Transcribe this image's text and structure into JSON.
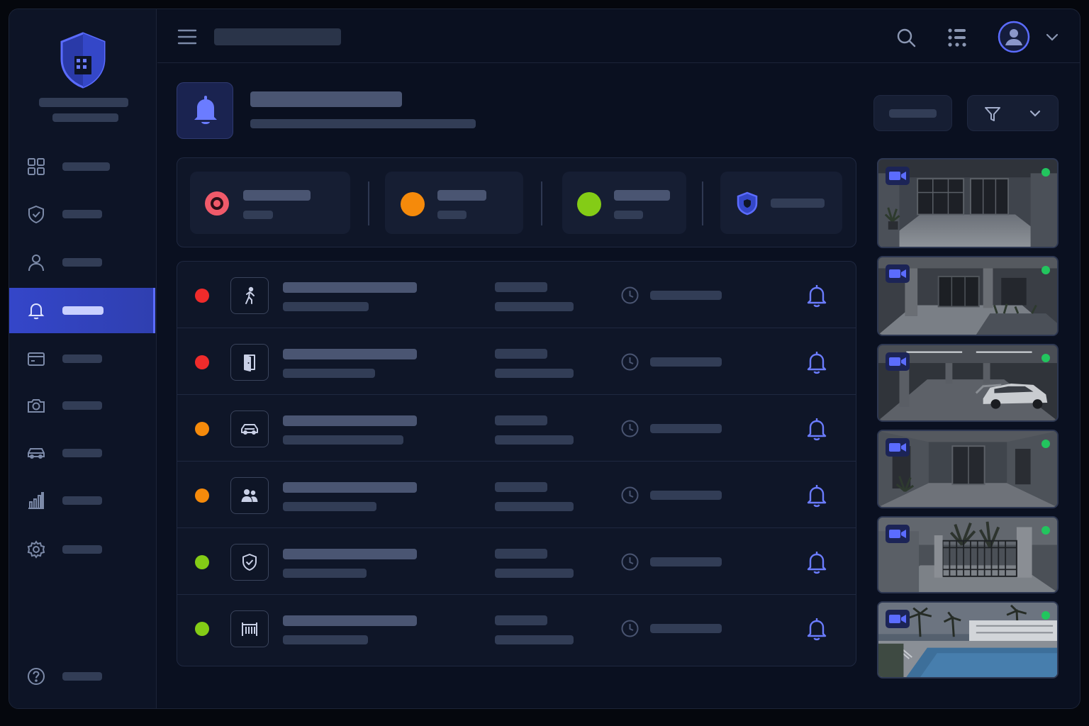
{
  "theme": {
    "accent": "#5b6cff",
    "critical": "#ef2b2b",
    "warning": "#f58a0b",
    "ok": "#84cc16",
    "live": "#22c55e",
    "critical_summary": "#f05a6a"
  },
  "sidebar": {
    "logo_icon": "shield-building-icon",
    "items": [
      {
        "icon": "dashboard-grid-icon"
      },
      {
        "icon": "shield-check-icon"
      },
      {
        "icon": "user-icon"
      },
      {
        "icon": "bell-icon",
        "active": true
      },
      {
        "icon": "access-card-icon"
      },
      {
        "icon": "camera-icon"
      },
      {
        "icon": "car-icon"
      },
      {
        "icon": "bar-chart-icon"
      },
      {
        "icon": "gear-icon"
      }
    ],
    "help_icon": "help-circle-icon"
  },
  "topbar": {
    "menu_icon": "hamburger-icon",
    "search_icon": "search-icon",
    "apps_icon": "apps-grid-icon",
    "avatar_icon": "user-avatar-icon",
    "dropdown_icon": "chevron-down-icon"
  },
  "header": {
    "icon": "bell-icon",
    "filter_icon": "filter-icon"
  },
  "summary": [
    {
      "severity": "critical",
      "icon": "target-dot-icon"
    },
    {
      "severity": "warning",
      "icon": "dot-icon"
    },
    {
      "severity": "ok",
      "icon": "dot-icon"
    },
    {
      "severity": "protected",
      "icon": "shield-icon"
    }
  ],
  "alerts": [
    {
      "severity": "critical",
      "icon": "running-person-icon"
    },
    {
      "severity": "critical",
      "icon": "door-icon"
    },
    {
      "severity": "warning",
      "icon": "car-icon"
    },
    {
      "severity": "warning",
      "icon": "group-icon"
    },
    {
      "severity": "ok",
      "icon": "shield-check-icon"
    },
    {
      "severity": "ok",
      "icon": "gate-icon"
    }
  ],
  "cameras": [
    {
      "scene": "lobby",
      "icon": "video-camera-icon",
      "status": "live"
    },
    {
      "scene": "courtyard",
      "icon": "video-camera-icon",
      "status": "live"
    },
    {
      "scene": "parking-garage",
      "icon": "video-camera-icon",
      "status": "live"
    },
    {
      "scene": "corridor",
      "icon": "video-camera-icon",
      "status": "live"
    },
    {
      "scene": "gate",
      "icon": "video-camera-icon",
      "status": "live"
    },
    {
      "scene": "pool",
      "icon": "video-camera-icon",
      "status": "live"
    }
  ]
}
